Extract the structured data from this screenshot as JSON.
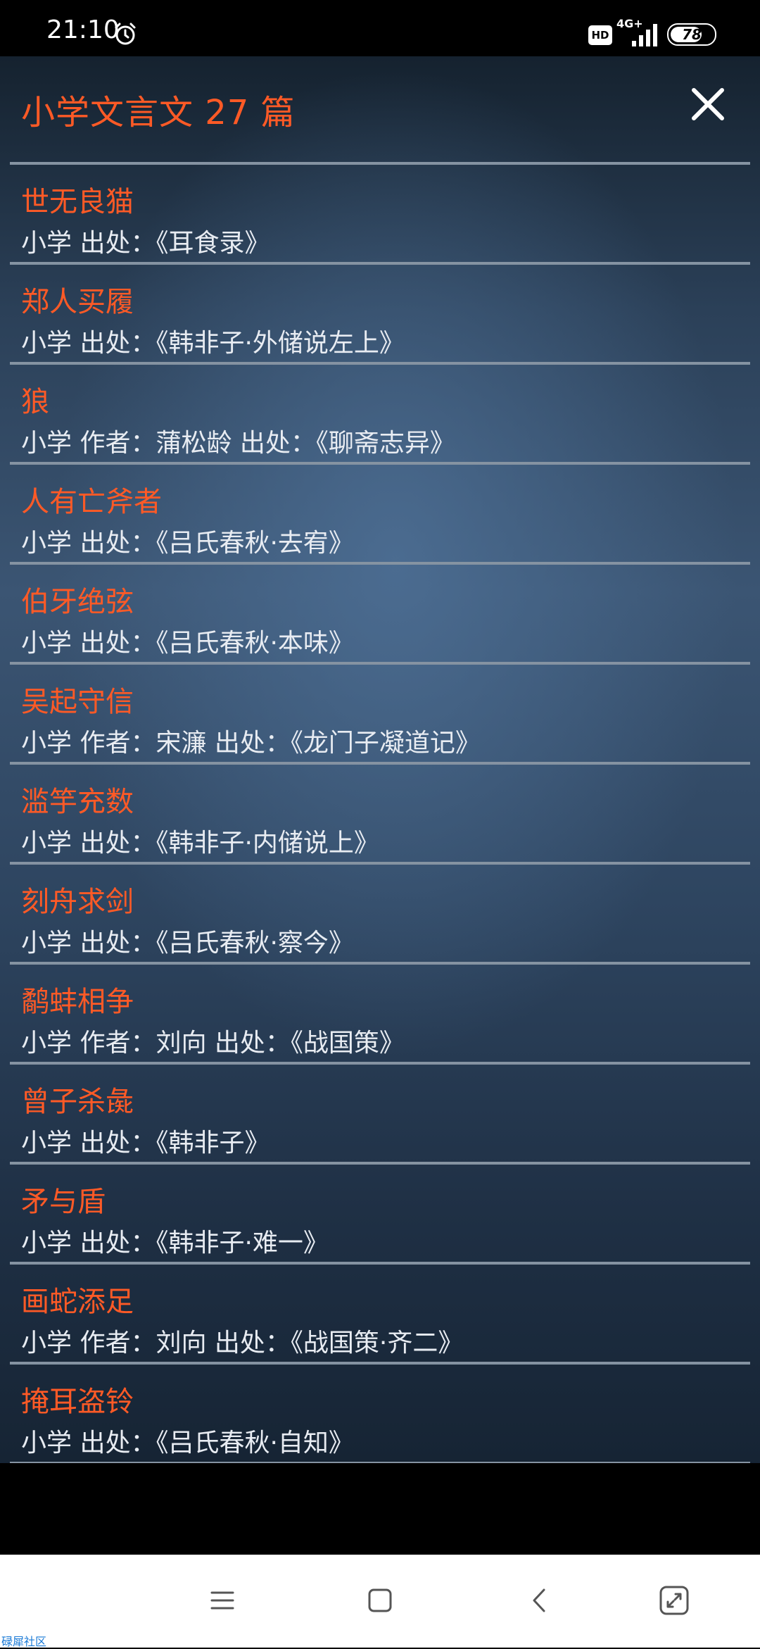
{
  "status_bar": {
    "time": "21:10",
    "network": "4G+",
    "hd": "HD",
    "battery": "78",
    "battery_level": 0.78
  },
  "header": {
    "title": "小学文言文 27 篇"
  },
  "items": [
    {
      "title": "世无良猫",
      "meta": "小学 出处：《耳食录》"
    },
    {
      "title": "郑人买履",
      "meta": "小学 出处：《韩非子·外储说左上》"
    },
    {
      "title": "狼",
      "meta": "小学 作者：蒲松龄 出处：《聊斋志异》"
    },
    {
      "title": "人有亡斧者",
      "meta": "小学 出处：《吕氏春秋·去宥》"
    },
    {
      "title": "伯牙绝弦",
      "meta": "小学 出处：《吕氏春秋·本味》"
    },
    {
      "title": "吴起守信",
      "meta": "小学 作者：宋濂 出处：《龙门子凝道记》"
    },
    {
      "title": "滥竽充数",
      "meta": "小学 出处：《韩非子·内储说上》"
    },
    {
      "title": "刻舟求剑",
      "meta": "小学 出处：《吕氏春秋·察今》"
    },
    {
      "title": "鹬蚌相争",
      "meta": "小学 作者：刘向 出处：《战国策》"
    },
    {
      "title": "曾子杀彘",
      "meta": "小学 出处：《韩非子》"
    },
    {
      "title": "矛与盾",
      "meta": "小学 出处：《韩非子·难一》"
    },
    {
      "title": "画蛇添足",
      "meta": "小学 作者：刘向 出处：《战国策·齐二》"
    },
    {
      "title": "掩耳盗铃",
      "meta": "小学 出处：《吕氏春秋·自知》"
    }
  ],
  "watermark": "碌犀社区",
  "colors": {
    "accent": "#ff5a26",
    "text": "#e8ecf2",
    "divider": "#8593a2"
  }
}
